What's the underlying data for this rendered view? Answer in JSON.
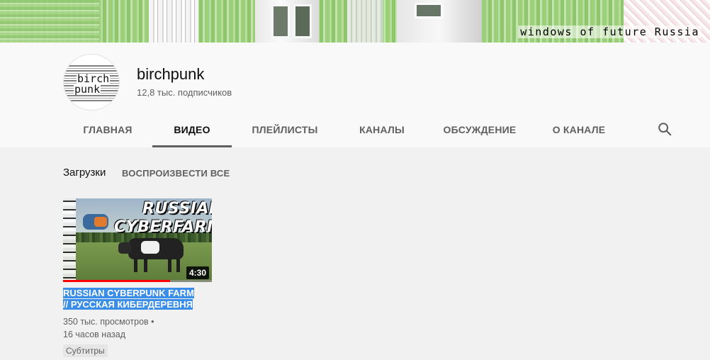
{
  "banner": {
    "caption": "windows of future Russia"
  },
  "channel": {
    "avatar_line1": "birch",
    "avatar_line2": "punk",
    "name": "birchpunk",
    "subscribers": "12,8 тыс. подписчиков"
  },
  "tabs": [
    {
      "label": "ГЛАВНАЯ",
      "active": false
    },
    {
      "label": "ВИДЕО",
      "active": true
    },
    {
      "label": "ПЛЕЙЛИСТЫ",
      "active": false
    },
    {
      "label": "КАНАЛЫ",
      "active": false
    },
    {
      "label": "ОБСУЖДЕНИЕ",
      "active": false
    },
    {
      "label": "О КАНАЛЕ",
      "active": false
    }
  ],
  "icons": {
    "search": "search-icon"
  },
  "section": {
    "title": "Загрузки",
    "play_all": "ВОСПРОИЗВЕСТИ ВСЕ"
  },
  "video": {
    "thumb_text_line1": "RUSSIAN",
    "thumb_text_line2": "CYBERFARM",
    "duration": "4:30",
    "watch_progress": 0.72,
    "title_line1": "RUSSIAN CYBERPUNK FARM",
    "title_line2": "// РУССКАЯ КИБЕРДЕРЕВНЯ",
    "views": "350 тыс. просмотров",
    "age": "16 часов назад",
    "badge": "Субтитры"
  },
  "colors": {
    "accent": "#ff0000",
    "selection": "#3b8ee8"
  }
}
